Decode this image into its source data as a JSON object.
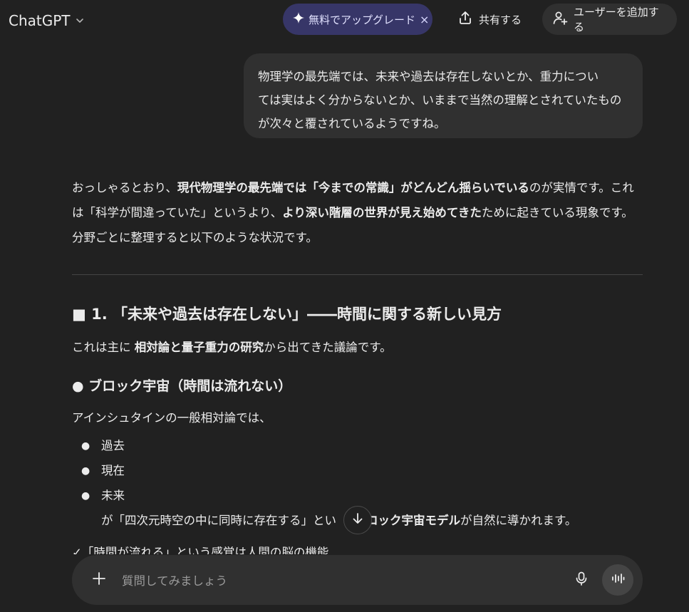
{
  "header": {
    "model_name": "ChatGPT",
    "upgrade_label": "無料でアップグレード",
    "upgrade_close": "×",
    "share_label": "共有する",
    "add_user_label": "ユーザーを追加する"
  },
  "user_message": {
    "line1": "物理学の最先端では、未来や過去は存在しないとか、重力につい",
    "line2": "ては実はよく分からないとか、いままで当然の理解とされていたもの",
    "line3": "が次々と覆されているようですね。"
  },
  "assistant": {
    "intro": {
      "l1_a": "おっしゃるとおり、",
      "l1_b": "現代物理学の最先端では「今までの常識」がどんどん揺らいでいる",
      "l1_c": "のが実情です。これ",
      "l2_a": "は「科学が間違っていた」というより、",
      "l2_b": "より深い階層の世界が見え始めてきた",
      "l2_c": "ために起きている現象です。",
      "l3": "分野ごとに整理すると以下のような状況です。"
    },
    "section1_heading": "■ 1. 「未来や過去は存在しない」――時間に関する新しい見方",
    "section1_text_a": "これは主に ",
    "section1_text_b": "相対論と量子重力の研究",
    "section1_text_c": "から出てきた議論です。",
    "subheading": "● ブロック宇宙（時間は流れない）",
    "einstein_text": "アインシュタインの一般相対論では、",
    "bullets": [
      "過去",
      "現在",
      "未来"
    ],
    "block_text_a": "が「四次元時空の中に同時に存在する」とい",
    "block_text_b": "ロック宇宙モデル",
    "block_text_c": "が自然に導かれます。",
    "check_text": "✓「時間が流れる」という感覚は人間の脳の機能"
  },
  "composer": {
    "placeholder": "質問してみましょう"
  },
  "icons": {
    "model_chevron": "chevron-down-icon",
    "upgrade": "sparkle-icon",
    "share": "share-upload-icon",
    "add_user": "add-user-icon",
    "scroll": "arrow-down-icon",
    "plus": "plus-icon",
    "mic": "microphone-icon",
    "voice": "voice-waveform-icon"
  }
}
